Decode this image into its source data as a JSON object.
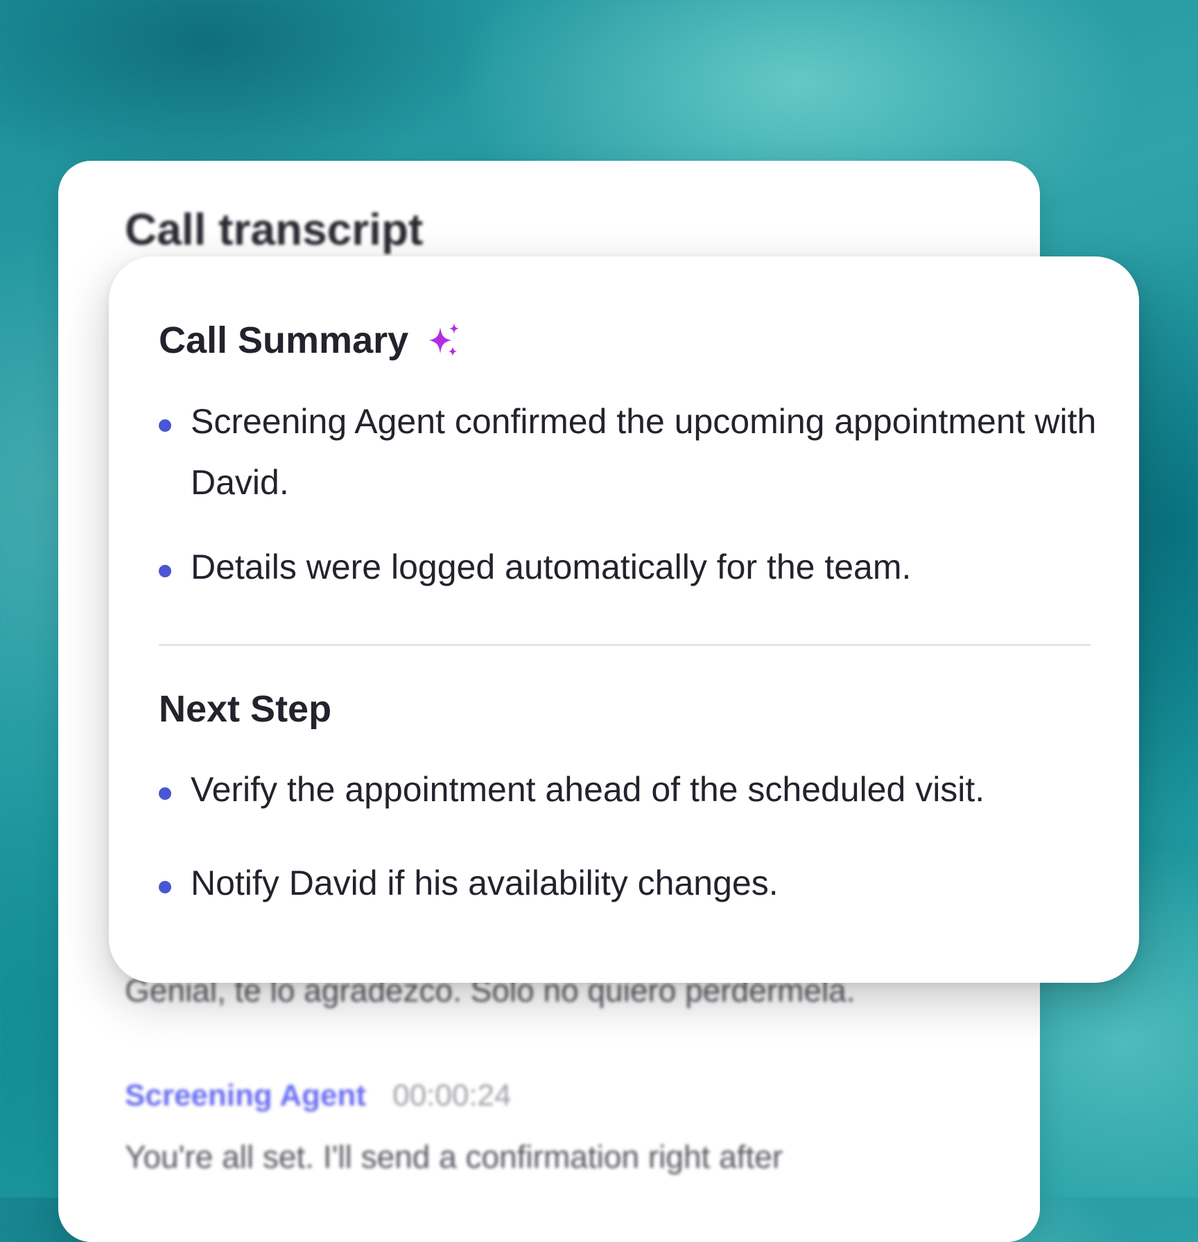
{
  "transcript": {
    "title": "Call transcript",
    "line_before": "Genial, te lo agradezco. Solo no quiero perdérmela.",
    "speaker_name": "Screening Agent",
    "timestamp": "00:00:24",
    "line_after": "You're all set. I'll send a confirmation right after"
  },
  "summary": {
    "heading": "Call Summary",
    "icon": "sparkle-icon",
    "items": [
      "Screening Agent confirmed the upcoming appointment with David.",
      "Details were logged automatically for the team."
    ]
  },
  "next_step": {
    "heading": "Next Step",
    "items": [
      "Verify the appointment ahead of the scheduled visit.",
      "Notify David if his availability changes."
    ]
  },
  "colors": {
    "bullet": "#4a56d4",
    "sparkle": "#b32de0",
    "speaker": "#6a6ef0"
  }
}
